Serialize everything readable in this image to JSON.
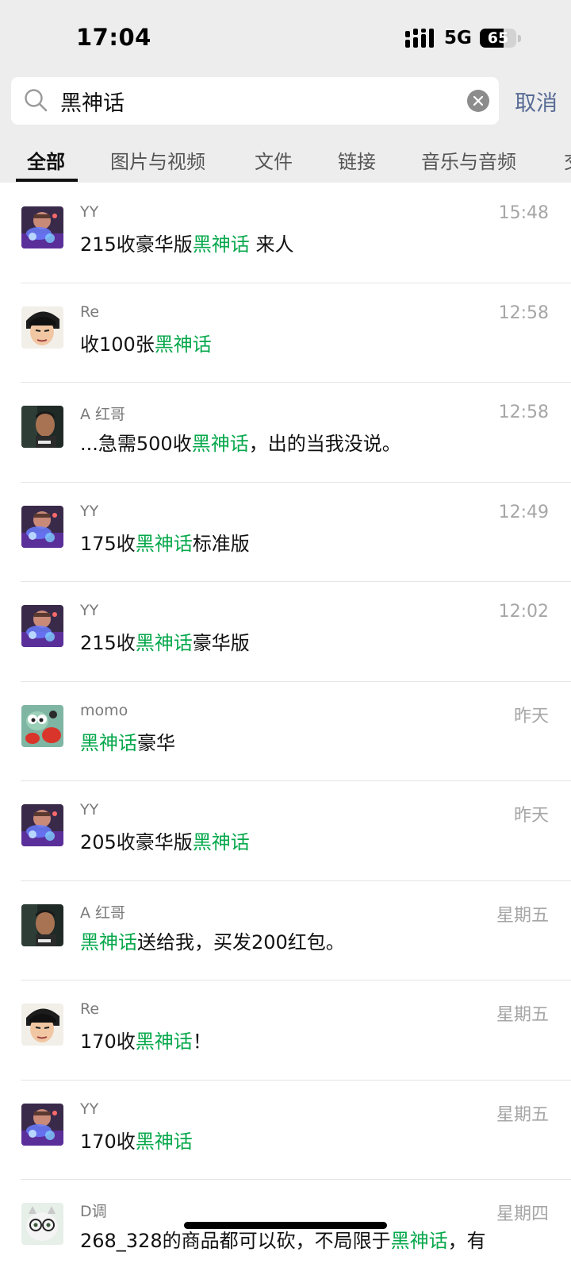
{
  "status_bar": {
    "time": "17:04",
    "network": "5G",
    "battery": "65",
    "battery_level": 0.65
  },
  "search": {
    "query": "黑神话",
    "cancel_label": "取消"
  },
  "tabs": [
    "全部",
    "图片与视频",
    "文件",
    "链接",
    "音乐与音频",
    "交"
  ],
  "highlight_color": "#07a84c",
  "results": [
    {
      "name": "YY",
      "time": "15:48",
      "before": "215收豪华版",
      "keyword": "黑神话",
      "after": " 来人",
      "avatar": "face-yy"
    },
    {
      "name": "Re",
      "time": "12:58",
      "before": "收100张",
      "keyword": "黑神话",
      "after": "",
      "avatar": "face-re"
    },
    {
      "name": "A 红哥",
      "time": "12:58",
      "before": "...急需500收",
      "keyword": "黑神话",
      "after": "，出的当我没说。",
      "avatar": "face-a"
    },
    {
      "name": "YY",
      "time": "12:49",
      "before": "175收",
      "keyword": "黑神话",
      "after": "标准版",
      "avatar": "face-yy"
    },
    {
      "name": "YY",
      "time": "12:02",
      "before": "215收",
      "keyword": "黑神话",
      "after": "豪华版",
      "avatar": "face-yy"
    },
    {
      "name": "momo",
      "time": "昨天",
      "before": "",
      "keyword": "黑神话",
      "after": "豪华",
      "avatar": "face-momo"
    },
    {
      "name": "YY",
      "time": "昨天",
      "before": "205收豪华版",
      "keyword": "黑神话",
      "after": "",
      "avatar": "face-yy"
    },
    {
      "name": "A 红哥",
      "time": "星期五",
      "before": "",
      "keyword": "黑神话",
      "after": "送给我，买发200红包。",
      "avatar": "face-a"
    },
    {
      "name": "Re",
      "time": "星期五",
      "before": "170收",
      "keyword": "黑神话",
      "after": "！",
      "avatar": "face-re"
    },
    {
      "name": "YY",
      "time": "星期五",
      "before": "170收",
      "keyword": "黑神话",
      "after": "",
      "avatar": "face-yy"
    },
    {
      "name": "D调",
      "time": "星期四",
      "before": "268_328的商品都可以砍，不局限于",
      "keyword": "黑神话",
      "after": "，有",
      "avatar": "face-d"
    }
  ]
}
